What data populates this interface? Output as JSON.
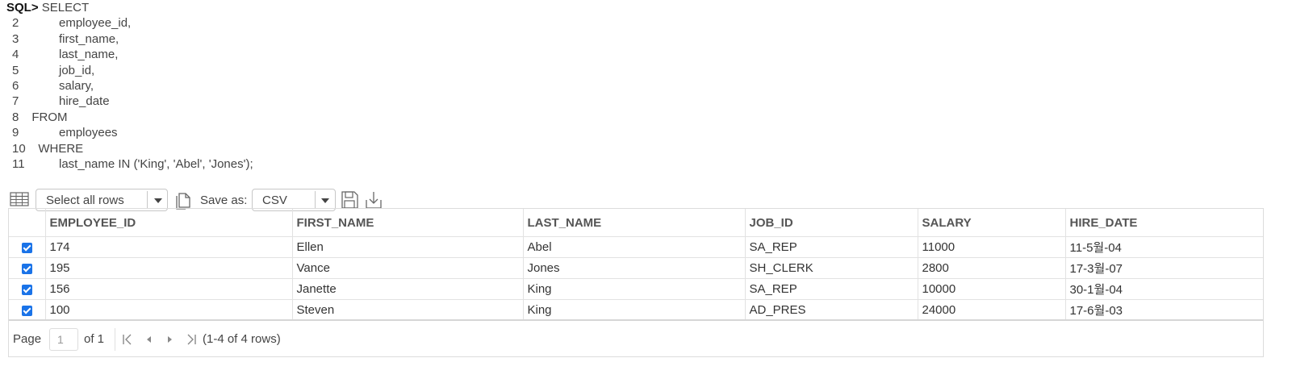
{
  "sql": {
    "prompt": "SQL>",
    "lines": [
      {
        "num": "",
        "text": " SELECT"
      },
      {
        "num": "2",
        "text": "      employee_id,"
      },
      {
        "num": "3",
        "text": "      first_name,"
      },
      {
        "num": "4",
        "text": "      last_name,"
      },
      {
        "num": "5",
        "text": "      job_id,"
      },
      {
        "num": "6",
        "text": "      salary,"
      },
      {
        "num": "7",
        "text": "      hire_date"
      },
      {
        "num": "8",
        "text": "  FROM"
      },
      {
        "num": "9",
        "text": "      employees"
      },
      {
        "num": "10",
        "text": "  WHERE"
      },
      {
        "num": "11",
        "text": "      last_name IN ('King', 'Abel', 'Jones');"
      }
    ]
  },
  "toolbar": {
    "select_rows_value": "Select all rows",
    "save_as_label": "Save as:",
    "format_value": "CSV",
    "icons": [
      "grid-icon",
      "copy-icon",
      "save-icon",
      "download-icon"
    ]
  },
  "grid": {
    "columns": [
      "EMPLOYEE_ID",
      "FIRST_NAME",
      "LAST_NAME",
      "JOB_ID",
      "SALARY",
      "HIRE_DATE"
    ],
    "rows": [
      {
        "checked": true,
        "cells": [
          "174",
          "Ellen",
          "Abel",
          "SA_REP",
          "11000",
          "11-5월-04"
        ]
      },
      {
        "checked": true,
        "cells": [
          "195",
          "Vance",
          "Jones",
          "SH_CLERK",
          "2800",
          "17-3월-07"
        ]
      },
      {
        "checked": true,
        "cells": [
          "156",
          "Janette",
          "King",
          "SA_REP",
          "10000",
          "30-1월-04"
        ]
      },
      {
        "checked": true,
        "cells": [
          "100",
          "Steven",
          "King",
          "AD_PRES",
          "24000",
          "17-6월-03"
        ]
      }
    ],
    "checkbox_color": "#1a73e8"
  },
  "pager": {
    "page_label": "Page",
    "page_value": "1",
    "of_label": "of 1",
    "range_text": "(1-4 of 4 rows)"
  }
}
